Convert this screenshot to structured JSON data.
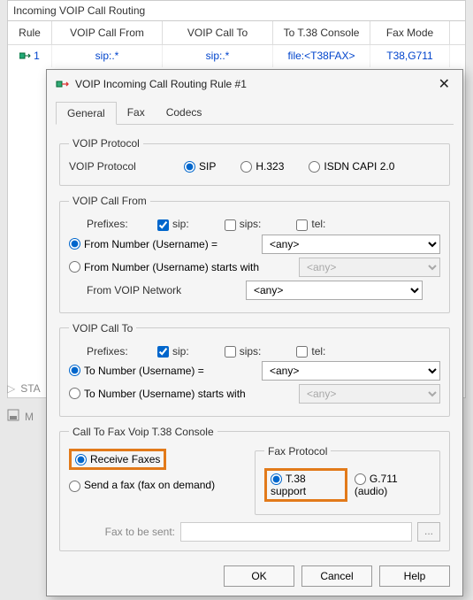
{
  "bg": {
    "title": "Incoming VOIP Call Routing",
    "headers": {
      "rule": "Rule",
      "from": "VOIP Call From",
      "to": "VOIP Call To",
      "console": "To T.38 Console",
      "mode": "Fax Mode"
    },
    "row": {
      "rule": "1",
      "from": "sip:.*",
      "to": "sip:.*",
      "console": "file:<T38FAX>",
      "mode": "T38,G711"
    },
    "start": "STA",
    "m": "M"
  },
  "dialog": {
    "title": "VOIP Incoming Call Routing Rule #1",
    "tabs": {
      "general": "General",
      "fax": "Fax",
      "codecs": "Codecs"
    },
    "voip_protocol_legend": "VOIP Protocol",
    "voip_protocol_label": "VOIP Protocol",
    "proto": {
      "sip": "SIP",
      "h323": "H.323",
      "isdn": "ISDN CAPI 2.0"
    },
    "call_from": {
      "legend": "VOIP Call From",
      "prefixes": "Prefixes:",
      "sip": "sip:",
      "sips": "sips:",
      "tel": "tel:",
      "from_eq": "From Number (Username) =",
      "from_sw": "From Number (Username) starts with",
      "from_net": "From VOIP Network",
      "any": "<any>"
    },
    "call_to": {
      "legend": "VOIP Call To",
      "prefixes": "Prefixes:",
      "sip": "sip:",
      "sips": "sips:",
      "tel": "tel:",
      "to_eq": "To Number (Username) =",
      "to_sw": "To Number (Username) starts with",
      "any": "<any>"
    },
    "fax": {
      "legend": "Call To Fax Voip T.38 Console",
      "receive": "Receive Faxes",
      "send": "Send a fax (fax on demand)",
      "proto_legend": "Fax Protocol",
      "t38": "T.38 support",
      "g711": "G.711 (audio)",
      "tobesent": "Fax to be sent:",
      "browse": "..."
    },
    "buttons": {
      "ok": "OK",
      "cancel": "Cancel",
      "help": "Help"
    }
  }
}
